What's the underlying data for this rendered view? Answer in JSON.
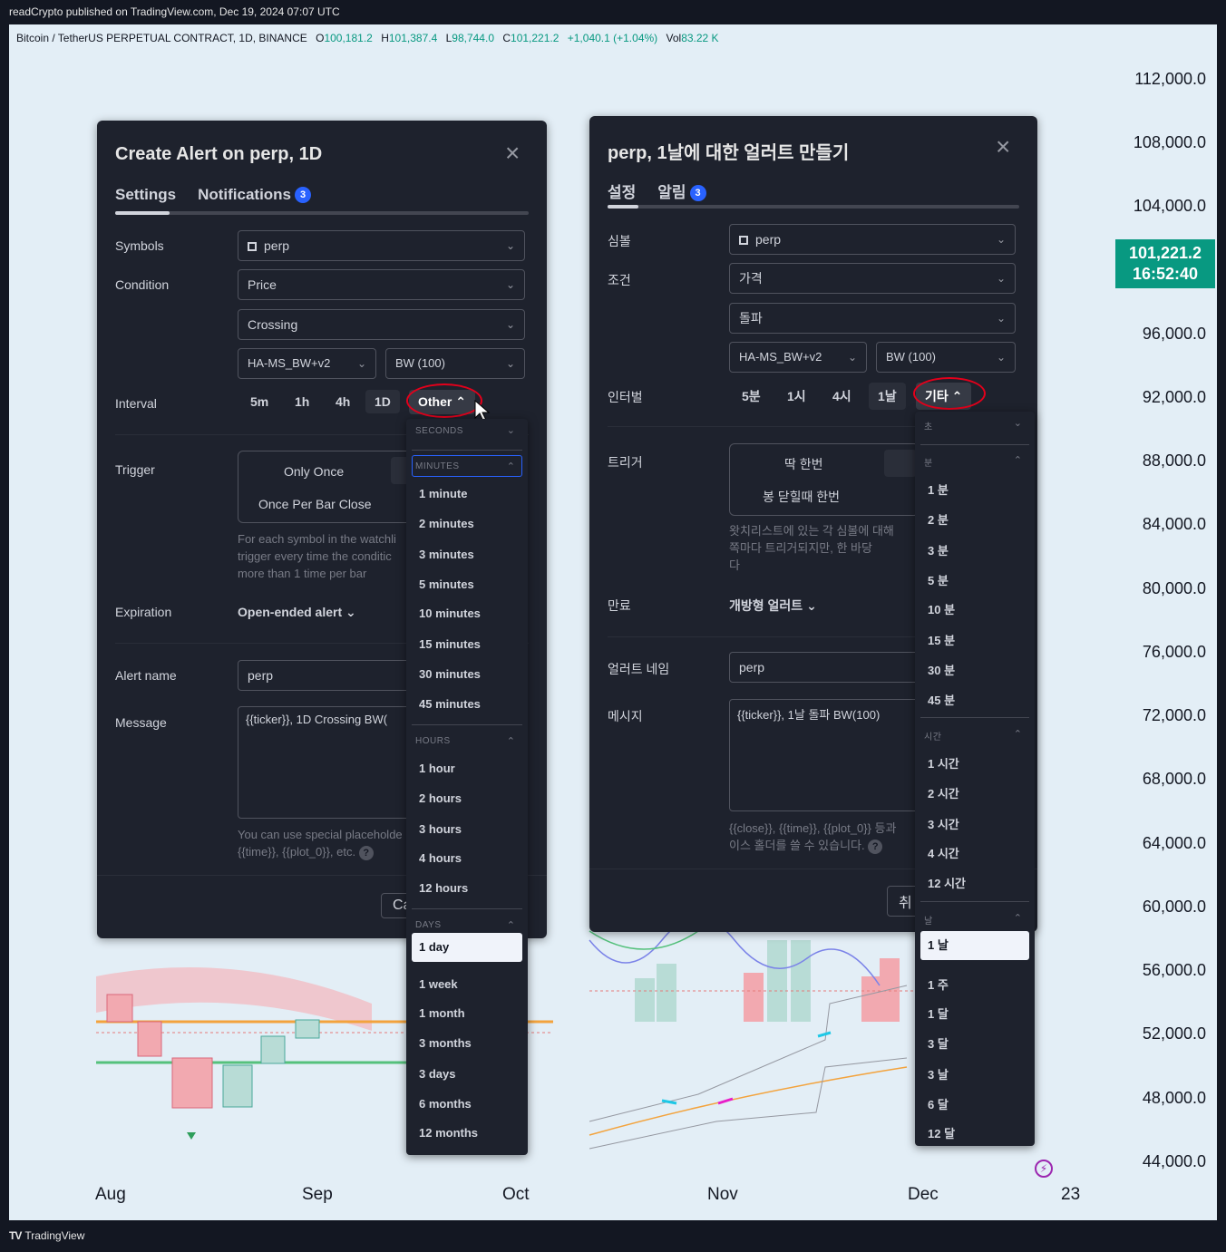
{
  "header": {
    "published": "readCrypto published on TradingView.com, Dec 19, 2024 07:07 UTC"
  },
  "footer": {
    "logo": "TV",
    "brand": "TradingView"
  },
  "legend": {
    "symbol": "Bitcoin / TetherUS PERPETUAL CONTRACT, 1D, BINANCE",
    "o_label": "O",
    "o": "100,181.2",
    "h_label": "H",
    "h": "101,387.4",
    "l_label": "L",
    "l": "98,744.0",
    "c_label": "C",
    "c": "101,221.2",
    "change": "+1,040.1 (+1.04%)",
    "vol_label": "Vol",
    "vol": "83.22 K"
  },
  "price_scale": [
    "112,000.0",
    "108,000.0",
    "104,000.0",
    "96,000.0",
    "92,000.0",
    "88,000.0",
    "84,000.0",
    "80,000.0",
    "76,000.0",
    "72,000.0",
    "68,000.0",
    "64,000.0",
    "60,000.0",
    "56,000.0",
    "52,000.0",
    "48,000.0",
    "44,000.0"
  ],
  "current_price": {
    "price": "101,221.2",
    "countdown": "16:52:40",
    "color": "#089981"
  },
  "time_axis": [
    "Aug",
    "Sep",
    "Oct",
    "Nov",
    "Dec",
    "23"
  ],
  "dialog_en": {
    "title": "Create Alert on perp, 1D",
    "tab_settings": "Settings",
    "tab_notifications": "Notifications",
    "badge": "3",
    "symbols_label": "Symbols",
    "symbols_value": "perp",
    "condition_label": "Condition",
    "condition_value": "Price",
    "crossing_value": "Crossing",
    "indicator_value": "HA-MS_BW+v2",
    "plot_value": "BW (100)",
    "interval_label": "Interval",
    "intervals": [
      "5m",
      "1h",
      "4h",
      "1D"
    ],
    "other_label": "Other",
    "trigger_label": "Trigger",
    "trigger_once": "Only Once",
    "trigger_bar": "Once Per Bar Close",
    "trigger_help": [
      "For each symbol in the watchli",
      "trigger every time the conditic",
      "more than 1 time per bar"
    ],
    "expiration_label": "Expiration",
    "expiration_value": "Open-ended alert",
    "alertname_label": "Alert name",
    "alertname_value": "perp",
    "message_label": "Message",
    "message_value": "{{ticker}}, 1D Crossing BW(",
    "placeholder_help": [
      "You can use special placeholde",
      "{{time}}, {{plot_0}}, etc."
    ],
    "cancel_partial": "Ca"
  },
  "dropdown_en": {
    "seconds": "SECONDS",
    "minutes": "MINUTES",
    "minute_items": [
      "1 minute",
      "2 minutes",
      "3 minutes",
      "5 minutes",
      "10 minutes",
      "15 minutes",
      "30 minutes",
      "45 minutes"
    ],
    "hours": "HOURS",
    "hour_items": [
      "1 hour",
      "2 hours",
      "3 hours",
      "4 hours",
      "12 hours"
    ],
    "days": "DAYS",
    "day_selected": "1 day",
    "day_items": [
      "1 week",
      "1 month",
      "3 months",
      "3 days",
      "6 months",
      "12 months"
    ]
  },
  "dialog_kr": {
    "title": "perp, 1날에 대한 얼러트 만들기",
    "tab_settings": "설정",
    "tab_notifications": "알림",
    "badge": "3",
    "symbols_label": "심볼",
    "symbols_value": "perp",
    "condition_label": "조건",
    "condition_value": "가격",
    "crossing_value": "돌파",
    "indicator_value": "HA-MS_BW+v2",
    "plot_value": "BW (100)",
    "interval_label": "인터벌",
    "intervals": [
      "5분",
      "1시",
      "4시",
      "1날"
    ],
    "other_label": "기타",
    "trigger_label": "트리거",
    "trigger_once": "딱 한번",
    "trigger_bar": "봉 닫힐때 한번",
    "trigger_help": [
      "왓치리스트에 있는 각 심볼에 대해",
      "쪽마다 트리거되지만, 한 바당 ",
      "다"
    ],
    "expiration_label": "만료",
    "expiration_value": "개방형 얼러트",
    "alertname_label": "얼러트 네임",
    "alertname_value": "perp",
    "message_label": "메시지",
    "message_value": "{{ticker}}, 1날 돌파 BW(100)",
    "placeholder_help": [
      "{{close}}, {{time}}, {{plot_0}} 등과",
      "이스 홀더를 쓸 수 있습니다."
    ],
    "cancel_partial": "취"
  },
  "dropdown_kr": {
    "seconds": "초",
    "minutes": "분",
    "minute_items": [
      "1 분",
      "2 분",
      "3 분",
      "5 분",
      "10 분",
      "15 분",
      "30 분",
      "45 분"
    ],
    "hours": "시간",
    "hour_items": [
      "1 시간",
      "2 시간",
      "3 시간",
      "4 시간",
      "12 시간"
    ],
    "days": "날",
    "day_selected": "1 날",
    "day_items": [
      "1 주",
      "1 달",
      "3 달",
      "3 날",
      "6 달",
      "12 달"
    ]
  },
  "colors": {
    "accent": "#2962ff",
    "annotation": "#e3001b",
    "panel": "#1e222d"
  }
}
